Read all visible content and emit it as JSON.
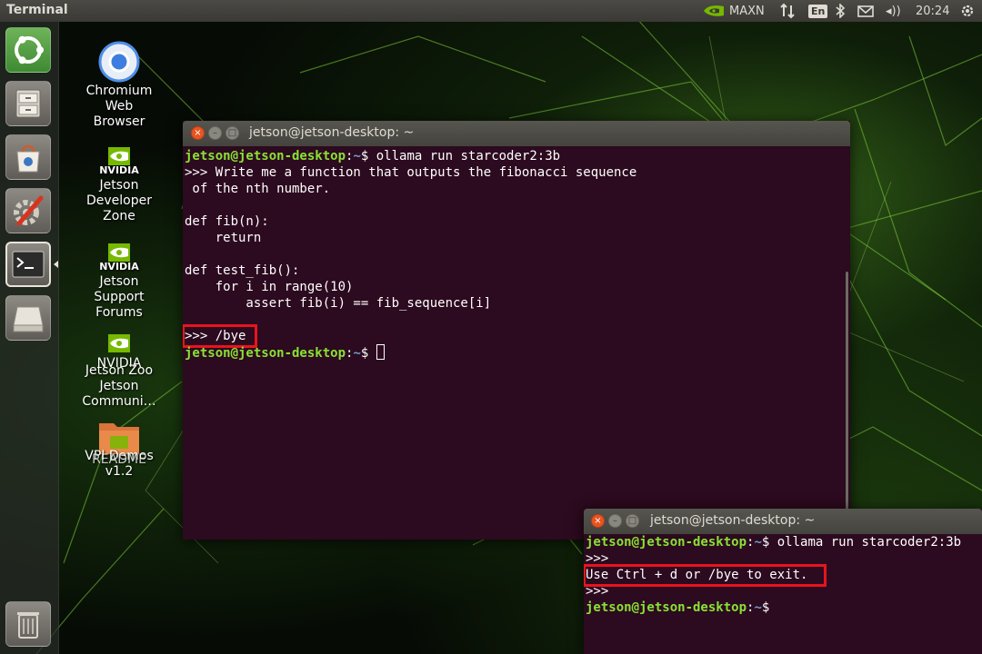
{
  "top_panel": {
    "app_title": "Terminal",
    "power_mode": "MAXN",
    "keyboard_lang": "En",
    "volume_label": "◂))",
    "clock": "20:24",
    "icons": [
      "nvidia-icon",
      "network-arrows-icon",
      "bluetooth-icon",
      "mail-icon",
      "volume-icon",
      "gear-icon"
    ]
  },
  "launcher": {
    "items": [
      {
        "name": "ubuntu-dash",
        "icon": "ubuntu-logo-icon"
      },
      {
        "name": "files",
        "icon": "file-cabinet-icon"
      },
      {
        "name": "software-center",
        "icon": "shopping-bag-icon"
      },
      {
        "name": "system-settings",
        "icon": "wrench-gear-icon"
      },
      {
        "name": "terminal",
        "icon": "terminal-icon",
        "active": true
      },
      {
        "name": "drive",
        "icon": "drive-icon"
      },
      {
        "name": "trash",
        "icon": "trash-icon"
      }
    ]
  },
  "desktop_icons": [
    {
      "name": "chromium",
      "icon": "chromium-icon",
      "lines": [
        "Chromium",
        "Web",
        "Browser"
      ]
    },
    {
      "name": "jetson-developer-zone",
      "icon": "nvidia-icon",
      "lines": [
        "Jetson",
        "Developer",
        "Zone"
      ]
    },
    {
      "name": "jetson-support-forums",
      "icon": "nvidia-icon",
      "lines": [
        "Jetson",
        "Support",
        "Forums"
      ]
    },
    {
      "name": "jetson-zoo",
      "icon": "nvidia-icon",
      "lines": [
        "NVIDIA",
        "Jetson Zoo",
        "Jetson",
        "Communi…"
      ]
    },
    {
      "name": "vpi-demos",
      "icon": "folder-icon",
      "lines": [
        "VPI Demos",
        "v1.2",
        "README"
      ]
    }
  ],
  "logo_text": "NVIDIA",
  "terminal_main": {
    "title": "jetson@jetson-desktop: ~",
    "prompt_user": "jetson@jetson-desktop",
    "prompt_sep": ":",
    "prompt_path": "~",
    "prompt_end": "$",
    "lines": [
      {
        "type": "prompt",
        "cmd": " ollama run starcoder2:3b"
      },
      {
        "type": "text",
        "text": ">>> Write me a function that outputs the fibonacci sequence"
      },
      {
        "type": "text",
        "text": " of the nth number."
      },
      {
        "type": "text",
        "text": ""
      },
      {
        "type": "text",
        "text": "def fib(n):"
      },
      {
        "type": "text",
        "text": "    return"
      },
      {
        "type": "text",
        "text": ""
      },
      {
        "type": "text",
        "text": "def test_fib():"
      },
      {
        "type": "text",
        "text": "    for i in range(10)"
      },
      {
        "type": "text",
        "text": "        assert fib(i) == fib_sequence[i]"
      },
      {
        "type": "text",
        "text": ""
      },
      {
        "type": "text",
        "text": ">>> /bye",
        "highlight": true
      },
      {
        "type": "prompt",
        "cmd": " ",
        "cursor": true
      }
    ]
  },
  "terminal_small": {
    "title": "jetson@jetson-desktop: ~",
    "lines": [
      {
        "type": "prompt",
        "cmd": " ollama run starcoder2:3b"
      },
      {
        "type": "text",
        "text": ">>>"
      },
      {
        "type": "text",
        "text": "Use Ctrl + d or /bye to exit.",
        "highlight": true
      },
      {
        "type": "text",
        "text": ">>>"
      },
      {
        "type": "prompt",
        "cmd": ""
      }
    ]
  },
  "colors": {
    "terminal_bg": "#2c0a1f",
    "prompt_user": "#8ae234",
    "prompt_path": "#729fcf",
    "highlight": "#e8141e",
    "close_button": "#e95420"
  }
}
